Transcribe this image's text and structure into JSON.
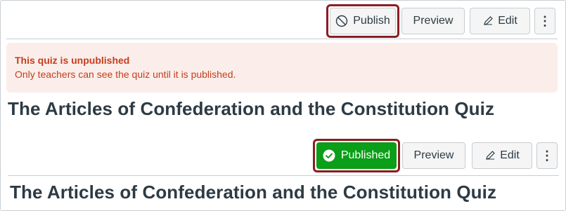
{
  "unpublished_state": {
    "toolbar": {
      "publish_label": "Publish",
      "preview_label": "Preview",
      "edit_label": "Edit",
      "more_glyph": "⋮"
    },
    "alert": {
      "title": "This quiz is unpublished",
      "message": "Only teachers can see the quiz until it is published."
    },
    "page_title": "The Articles of Confederation and the Constitution Quiz"
  },
  "published_state": {
    "toolbar": {
      "published_label": "Published",
      "preview_label": "Preview",
      "edit_label": "Edit",
      "more_glyph": "⋮"
    },
    "page_title": "The Articles of Confederation and the Constitution Quiz"
  },
  "icons": {
    "publish": "no-entry-circle-icon",
    "published": "check-circle-icon",
    "edit": "pencil-icon",
    "more": "vertical-ellipsis-icon"
  },
  "colors": {
    "highlight_ring": "#8b1c24",
    "published_green": "#0b9e18",
    "alert_bg": "#fbeeea",
    "alert_text": "#c73c1c",
    "title_text": "#2d3b45"
  }
}
